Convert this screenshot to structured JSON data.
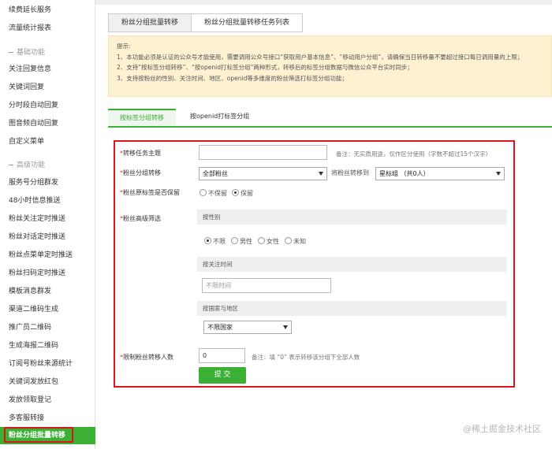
{
  "sidebar": {
    "items_top": [
      "续费延长服务",
      "流量统计报表"
    ],
    "section_basic": "基础功能",
    "items_basic": [
      "关注回复信息",
      "关键词回复",
      "分时段自动回复",
      "图音频自动回复",
      "自定义菜单"
    ],
    "section_advanced": "高级功能",
    "items_advanced": [
      "服务号分组群发",
      "48小时信息推送",
      "粉丝关注定时推送",
      "粉丝对话定时推送",
      "粉丝点菜单定时推送",
      "粉丝扫码定时推送",
      "模板消息群发",
      "渠道二维码生成",
      "推广员二维码",
      "生成海报二维码",
      "订阅号粉丝来源统计",
      "关键词发放红包",
      "发放领取登记",
      "多客服转接"
    ],
    "active_item": "粉丝分组批量转移"
  },
  "tabs": [
    "粉丝分组批量转移",
    "粉丝分组批量转移任务列表"
  ],
  "tips": {
    "title": "提示:",
    "line1": "1、本功能必须是认证的公众号才能使用，需要调用公众号接口“获取用户基本信息”、“移动用户分组”，请确保当日转移量不要超过接口每日调用量的上限；",
    "line2": "2、支持“按标签分组转移”、“按openid打标签分组”两种形式，转移后的标签分组数据与微信公众平台实时同步；",
    "line3": "3、支持按粉丝的性别、关注时间、地区、openid等多维度的粉丝筛选打标签分组功能；"
  },
  "subtabs": [
    "按标签分组转移",
    "按openid打标签分组"
  ],
  "form": {
    "required_mark": "*",
    "task_label": "转移任务主题",
    "task_note": "备注：无实质用途，仅作区分使用（字数不超过15个汉字）",
    "group_label": "粉丝分组转移",
    "group_value": "全部粉丝",
    "move_to_label": "将粉丝转移到",
    "move_to_value": "星标组 （共0人）",
    "keep_label": "粉丝原标签是否保留",
    "keep_options": [
      "不保留",
      "保留"
    ],
    "keep_selected": 1,
    "filter_label": "粉丝高级筛选",
    "gender_bar": "按性别",
    "gender_options": [
      "不限",
      "男性",
      "女性",
      "未知"
    ],
    "gender_selected": 0,
    "time_bar": "按关注时间",
    "time_placeholder": "不限时间",
    "region_bar": "按国家与地区",
    "region_value": "不限国家",
    "limit_label": "限制粉丝转移人数",
    "limit_value": "0",
    "limit_note": "备注：填 “0” 表示转移该分组下全部人数",
    "submit_label": "提 交"
  },
  "watermark": "@稀土掘金技术社区",
  "colors": {
    "accent": "#3cb034",
    "highlight_border": "#d9151d",
    "tips_bg": "#fdf1d2"
  }
}
